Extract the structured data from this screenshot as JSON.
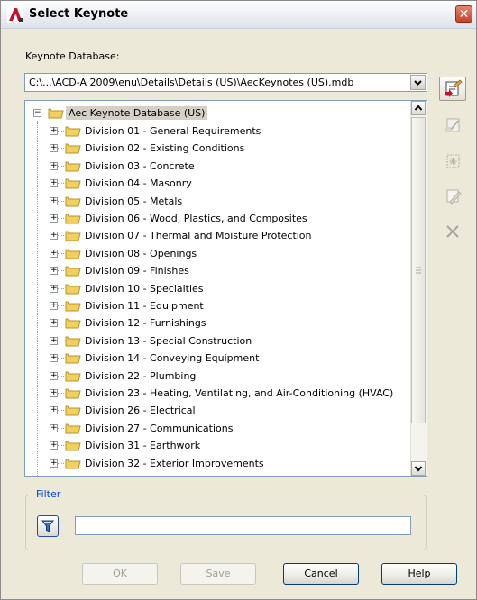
{
  "window": {
    "title": "Select Keynote",
    "close_glyph": "✕"
  },
  "database": {
    "label": "Keynote Database:",
    "path": "C:\\...\\ACD-A 2009\\enu\\Details\\Details (US)\\AecKeynotes (US).mdb"
  },
  "tree": {
    "root": "Aec Keynote Database (US)",
    "items": [
      "Division 01 - General Requirements",
      "Division 02 - Existing Conditions",
      "Division 03 - Concrete",
      "Division 04 - Masonry",
      "Division 05 - Metals",
      "Division 06 - Wood, Plastics, and Composites",
      "Division 07 - Thermal and Moisture Protection",
      "Division 08 - Openings",
      "Division 09 - Finishes",
      "Division 10 - Specialties",
      "Division 11 - Equipment",
      "Division 12 - Furnishings",
      "Division 13 - Special Construction",
      "Division 14 - Conveying Equipment",
      "Division 22 - Plumbing",
      "Division 23 - Heating, Ventilating, and Air-Conditioning (HVAC)",
      "Division 26 - Electrical",
      "Division 27 - Communications",
      "Division 31 - Earthwork",
      "Division 32 - Exterior Improvements"
    ]
  },
  "side_toolbar": {
    "icons": [
      "open-database-icon",
      "add-keynote-icon",
      "add-group-icon",
      "edit-keynote-icon",
      "delete-icon"
    ]
  },
  "filter": {
    "legend": "Filter",
    "value": "",
    "icon": "filter-funnel-icon"
  },
  "buttons": {
    "ok": "OK",
    "save": "Save",
    "cancel": "Cancel",
    "help": "Help"
  },
  "colors": {
    "accent": "#0046d5",
    "selection": "#d4d0c8",
    "folder": "#f2cf5f"
  }
}
